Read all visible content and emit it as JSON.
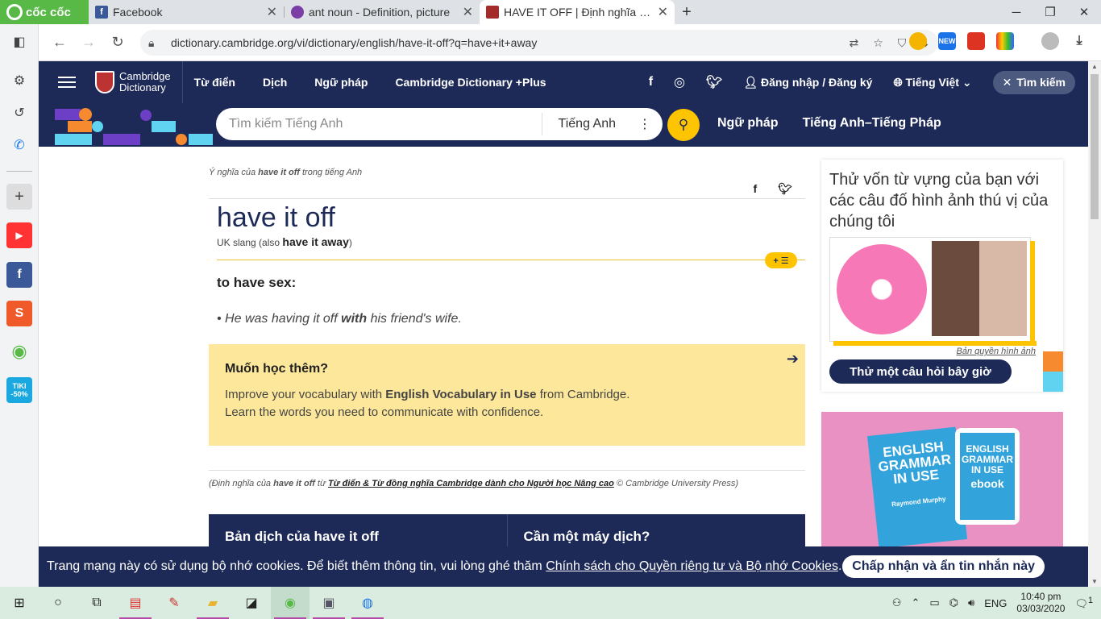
{
  "browser": {
    "brand": "cốc cốc",
    "tabs": [
      {
        "title": "Facebook",
        "favicon_color": "#3b5998",
        "favicon": "f"
      },
      {
        "title": "ant noun - Definition, picture",
        "favicon_color": "#7a3ea5",
        "favicon": "o"
      },
      {
        "title": "HAVE IT OFF | Định nghĩa trong",
        "favicon_color": "#a52a2a",
        "favicon": "C"
      }
    ],
    "url": "dictionary.cambridge.org/vi/dictionary/english/have-it-off?q=have+it+away"
  },
  "header": {
    "logo_line1": "Cambridge",
    "logo_line2": "Dictionary",
    "nav": [
      "Từ điển",
      "Dịch",
      "Ngữ pháp",
      "Cambridge Dictionary +Plus"
    ],
    "login": "Đăng nhập / Đăng ký",
    "language": "Tiếng Việt",
    "search_toggle": "Tìm kiếm"
  },
  "search": {
    "placeholder": "Tìm kiếm Tiếng Anh",
    "language": "Tiếng Anh",
    "links": [
      "Ngữ pháp",
      "Tiếng Anh–Tiếng Pháp"
    ]
  },
  "entry": {
    "crumb_pre": "Ý nghĩa của ",
    "crumb_word": "have it off",
    "crumb_post": " trong tiếng Anh",
    "headword": "have it off",
    "label": "UK slang",
    "also_pre": "(also ",
    "also_word": "have it away",
    "also_post": ")",
    "definition": "to have sex:",
    "example_pre": "He was having it off ",
    "example_bold": "with",
    "example_post": " his friend's wife."
  },
  "learn_more": {
    "title": "Muốn học thêm?",
    "line1_pre": "Improve your vocabulary with ",
    "line1_bold": "English Vocabulary in Use",
    "line1_post": " from Cambridge.",
    "line2": "Learn the words you need to communicate with confidence."
  },
  "citation": {
    "pre": "(Định nghĩa của ",
    "word": "have it off",
    "mid": " từ ",
    "link": "Từ điển & Từ đồng nghĩa Cambridge dành cho Người học Nâng cao",
    "post": " © Cambridge University Press)"
  },
  "translation_box": {
    "left_pre": "Bản dịch của ",
    "left_word": "have it off",
    "right": "Cần một máy dịch?"
  },
  "quiz": {
    "title": "Thử vốn từ vựng của bạn với các câu đố hình ảnh thú vị của chúng tôi",
    "copyright": "Bản quyền hình ảnh",
    "button": "Thử một câu hỏi bây giờ"
  },
  "ad": {
    "book_line1": "ENGLISH",
    "book_line2": "GRAMMAR",
    "book_line3": "IN USE",
    "book_author": "Raymond Murphy",
    "tablet_line1": "ENGLISH",
    "tablet_line2": "GRAMMAR",
    "tablet_line3": "IN USE",
    "tablet_line4": "ebook"
  },
  "cookie": {
    "text_pre": "Trang mạng này có sử dụng bộ nhớ cookies. Để biết thêm thông tin, vui lòng ghé thăm ",
    "link": "Chính sách cho Quyền riêng tư và Bộ nhớ Cookies",
    "text_post": ".",
    "accept": "Chấp nhận và ẩn tin nhắn này"
  },
  "sidebar_badge": "TIKI -50%",
  "extension_badge": "NEW",
  "taskbar": {
    "lang": "ENG",
    "time": "10:40 pm",
    "date": "03/03/2020",
    "notif_count": "1"
  }
}
